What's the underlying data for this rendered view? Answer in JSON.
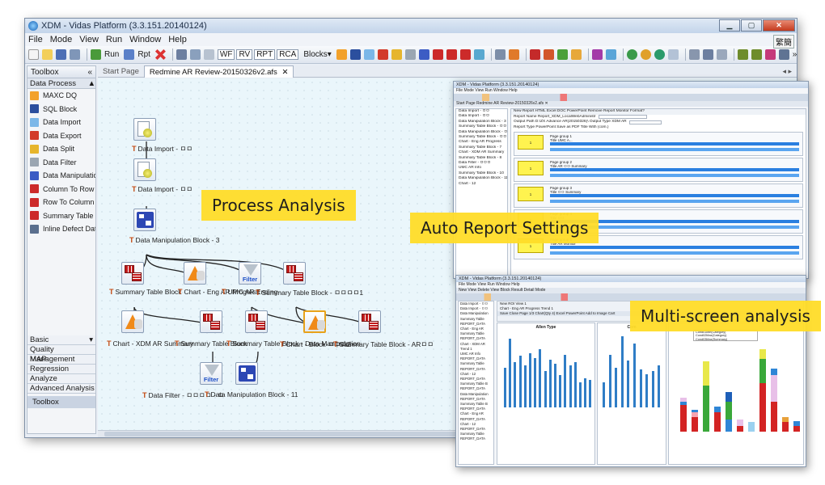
{
  "window": {
    "title": "XDM - Vidas Platform (3.3.151.20140124)",
    "lang_badge": "繁簡"
  },
  "menu": [
    "File",
    "Mode",
    "View",
    "Run",
    "Window",
    "Help"
  ],
  "toolbar": {
    "run": "Run",
    "rpt": "Rpt",
    "wf": "WF",
    "rv": "RV",
    "rpt2": "RPT",
    "rca": "RCA",
    "blocks": "Blocks▾",
    "more": "»"
  },
  "toolbox": {
    "title": "Toolbox",
    "collapse": "«",
    "category": "Data Process",
    "items": [
      {
        "label": "MAXC DQ",
        "color": "#f2a12a"
      },
      {
        "label": "SQL Block",
        "color": "#2b4f9e"
      },
      {
        "label": "Data Import",
        "color": "#7bb7e8"
      },
      {
        "label": "Data Export",
        "color": "#d23a2a"
      },
      {
        "label": "Data Split",
        "color": "#e6b52c"
      },
      {
        "label": "Data Filter",
        "color": "#9aa6b2"
      },
      {
        "label": "Data Manipulatio...",
        "color": "#3c5cc4"
      },
      {
        "label": "Column To Row",
        "color": "#cc2a2a"
      },
      {
        "label": "Row To Column",
        "color": "#cc2a2a"
      },
      {
        "label": "Summary Table ...",
        "color": "#cc2a2a"
      },
      {
        "label": "Inline Defect Data",
        "color": "#5a6f8e"
      }
    ],
    "lower_categories": [
      "Basic",
      "Quality Management",
      "MAP",
      "Regression",
      "Analyze",
      "Advanced Analysis"
    ],
    "footer": "Toolbox"
  },
  "tabs": {
    "start": "Start Page",
    "active": "Redmine AR Review-20150326v2.afs",
    "close": "✕",
    "nav": "◂ ▸"
  },
  "nodes": [
    {
      "label": "Data Import - ㅁㅁ"
    },
    {
      "label": "Data Import - ㅁㅁ"
    },
    {
      "label": "Data Manipulation Block - 3"
    },
    {
      "label": "Summary Table Block"
    },
    {
      "label": "Chart - Eng AR Progress"
    },
    {
      "label": "UMC AR Ending"
    },
    {
      "label": "Summary Table Block - ㅁㅁㅁㅁ1"
    },
    {
      "label": "Chart - XDM AR Summary"
    },
    {
      "label": "Summary Table Block"
    },
    {
      "label": "Summary Table Block - Data Manipulation"
    },
    {
      "label": "Chart - Block-ㅁㅁㅁ2"
    },
    {
      "label": "Summary Table Block - ARㅁㅁ"
    },
    {
      "label": "Data Filter - ㅁㅁㅁㅁ - ㅁ"
    },
    {
      "label": "Data Manipulation Block - 11"
    }
  ],
  "filter_text": "Filter",
  "callouts": {
    "process": "Process Analysis",
    "report": "Auto Report Settings",
    "multi": "Multi-screen analysis"
  },
  "report_shot": {
    "title": "XDM - Vidas Platform (3.3.151.20140124)",
    "menu": "File  Mode  View  Run  Window  Help",
    "tabs": "Start Page    Redmine AR Review-20150326v2.afs  ✕",
    "tree": [
      "Data Import - ㅁㅁ",
      "Data Import - ㅁㅁ",
      "Data Manipulation Block - 3",
      "Summary Table Block - ㅁㅁㅁ",
      "Data Manipulation Block - ㅁㅁ",
      "Summary Table Block - ㅁㅁ",
      "Chart - Eng AR Progress",
      "Summary Table Block - 7",
      "Chart - XDM AR Summary",
      "Summary Table Block - 8",
      "Data Filter - ㅁㅁㅁ",
      "UMC AR Info",
      "Summary Table Block - 10",
      "Data Manipulation Block - 11",
      "Chart - 12"
    ],
    "header_row": "New Report   HTML   Excel   DOC   PowerPoint   Remove Report   Monitor Format?",
    "rows": [
      "Report Name  Report_XDM_LocalWebAdministr",
      "Output Path  D:\\ZX Advance AR(20150326)\\   Output Type  XDM AR",
      "Report Type  PowerPoint   Save as PDF   Title With (com.)"
    ],
    "groups": [
      {
        "name": "Page group 1",
        "title": "Title  UMC A... ",
        "bar": "Summary Table Block - XDM_AR_REPORT_2015 Summary"
      },
      {
        "name": "Page group 2",
        "title": "Title  AR ㅁㅁ Summary",
        "bar": "Data Manipulation Block - ㅁㅁ REPORT_2015 Summary"
      },
      {
        "name": "Page group 3",
        "title": "Title  ㅁㅁ Summary",
        "bar": "Summary Table Block - Trend 1"
      },
      {
        "name": "Page group 4",
        "title": "Title  ㅁㅁ",
        "bar": "Data Manipulation Block - AR ㅁㅁ REPORT_2015 Summary"
      },
      {
        "name": "Page group 5",
        "title": "Title  AR Monitor",
        "bar": "Chart - Eng AR Progress Trend 1"
      }
    ],
    "swatch": "1"
  },
  "multi_shot": {
    "title": "XDM - Vidas Platform (3.3.151.20140124)",
    "menu": "File  Mode  View  Run  Window  Help",
    "tabs": "New View   Delete View   Block Result   Detail Mode",
    "header_rows": [
      "New ROI View 1",
      "Chart - Eng AR Progress Trend 1",
      "Save  Close  Page 1/3  Chart(Qty 4)  Excel  PowerPoint  Add to Image Cart"
    ],
    "tree": [
      "Data Import - ㅁㅁ",
      "Data Import - ㅁㅁ",
      "Data Manipulation",
      "Summary Table",
      "REPORT_DATA",
      "Chart - Eng AR",
      "Summary Table",
      "REPORT_DATA",
      "Chart - XDM AR",
      "Trend 1",
      "UMC AR Info",
      "REPORT_DATA",
      "Summary Table",
      "REPORT_DATA",
      "Chart - 12",
      "REPORT_DATA",
      "Summary Table B",
      "REPORT_DATA",
      "Data Manipulation",
      "REPORT_DATA",
      "Summary Table B",
      "REPORT_DATA",
      "Chart - Eng AR",
      "REPORT_DATA",
      "Chart - 12",
      "REPORT_DATA",
      "Summary Table",
      "REPORT_DATA"
    ],
    "pane1_title": "Allen Type",
    "pane2_title": "Com",
    "pane1_bars": [
      0.55,
      0.95,
      0.62,
      0.71,
      0.58,
      0.74,
      0.68,
      0.8,
      0.5,
      0.66,
      0.6,
      0.45,
      0.72,
      0.58,
      0.62,
      0.35,
      0.4,
      0.38
    ],
    "pane2_bars": [
      0.35,
      0.72,
      0.55,
      0.98,
      0.64,
      0.88,
      0.52,
      0.46,
      0.5,
      0.58
    ],
    "pane3_stacks": [
      [
        {
          "v": 0.22,
          "c": "#d32424"
        },
        {
          "v": 0.03,
          "c": "#2f86d6"
        },
        {
          "v": 0.03,
          "c": "#e8c0e8"
        }
      ],
      [
        {
          "v": 0.12,
          "c": "#d32424"
        },
        {
          "v": 0.04,
          "c": "#f7a5b0"
        },
        {
          "v": 0.02,
          "c": "#2f86d6"
        }
      ],
      [
        {
          "v": 0.38,
          "c": "#3aa83a"
        },
        {
          "v": 0.2,
          "c": "#e8e84a"
        }
      ],
      [
        {
          "v": 0.16,
          "c": "#d32424"
        },
        {
          "v": 0.05,
          "c": "#2f86d6"
        }
      ],
      [
        {
          "v": 0.1,
          "c": "#2f86d6"
        },
        {
          "v": 0.15,
          "c": "#3aa83a"
        },
        {
          "v": 0.08,
          "c": "#1e5fb8"
        }
      ],
      [
        {
          "v": 0.05,
          "c": "#d32424"
        },
        {
          "v": 0.05,
          "c": "#e8c0e8"
        }
      ],
      [
        {
          "v": 0.08,
          "c": "#9bd1f0"
        }
      ],
      [
        {
          "v": 0.4,
          "c": "#d32424"
        },
        {
          "v": 0.2,
          "c": "#3aa83a"
        },
        {
          "v": 0.08,
          "c": "#e8e84a"
        }
      ],
      [
        {
          "v": 0.25,
          "c": "#d32424"
        },
        {
          "v": 0.22,
          "c": "#e8c0e8"
        },
        {
          "v": 0.05,
          "c": "#2f86d6"
        }
      ],
      [
        {
          "v": 0.08,
          "c": "#d32424"
        },
        {
          "v": 0.04,
          "c": "#e8a13a"
        }
      ],
      [
        {
          "v": 0.05,
          "c": "#d32424"
        },
        {
          "v": 0.04,
          "c": "#2f86d6"
        }
      ]
    ],
    "legend": [
      "Cond01Min(Category)",
      "Cond02Max(Category)",
      "Cond03Max(Summary)",
      "Cond04Max(Roadmap_2015Q4)"
    ]
  }
}
